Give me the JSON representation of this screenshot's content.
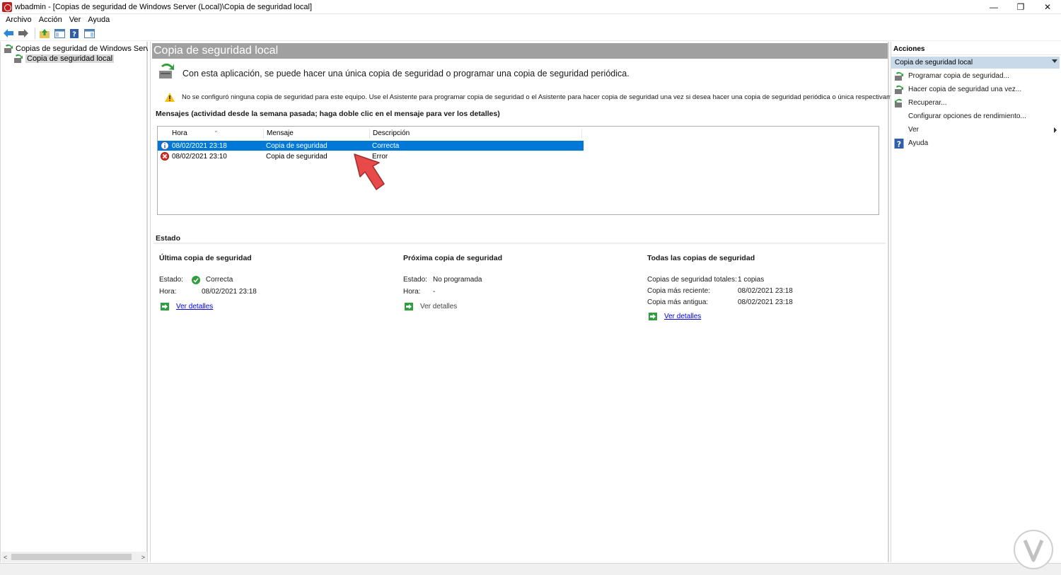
{
  "window": {
    "title": "wbadmin - [Copias de seguridad de Windows Server (Local)\\Copia de seguridad local]",
    "minimize": "—",
    "maximize": "❐",
    "close": "✕"
  },
  "menu": [
    "Archivo",
    "Acción",
    "Ver",
    "Ayuda"
  ],
  "tree": {
    "root": "Copias de seguridad de Windows Server (Local)",
    "child": "Copia de seguridad local"
  },
  "center": {
    "header": "Copia de seguridad local",
    "intro": "Con esta aplicación, se puede hacer una única copia de seguridad o programar una copia de seguridad periódica.",
    "warning": "No se configuró ninguna copia de seguridad para este equipo. Use el Asistente para programar copia de seguridad o el Asistente para hacer copia de seguridad una vez si desea hacer una copia de seguridad periódica o única respectivamente.",
    "messages_heading": "Mensajes (actividad desde la semana pasada; haga doble clic en el mensaje para ver los detalles)",
    "columns": [
      "Hora",
      "Mensaje",
      "Descripción"
    ],
    "rows": [
      {
        "time": "08/02/2021 23:18",
        "message": "Copia de seguridad",
        "description": "Correcta",
        "icon": "info-icon",
        "selected": true
      },
      {
        "time": "08/02/2021 23:10",
        "message": "Copia de seguridad",
        "description": "Error",
        "icon": "error-icon",
        "selected": false
      }
    ],
    "estado_title": "Estado",
    "last": {
      "title": "Última copia de seguridad",
      "estado_label": "Estado:",
      "estado_value": "Correcta",
      "hora_label": "Hora:",
      "hora_value": "08/02/2021 23:18",
      "link": "Ver detalles"
    },
    "next": {
      "title": "Próxima copia de seguridad",
      "estado_label": "Estado:",
      "estado_value": "No programada",
      "hora_label": "Hora:",
      "hora_value": "-",
      "link": "Ver detalles"
    },
    "all": {
      "title": "Todas las copias de seguridad",
      "total_label": "Copias de seguridad totales:",
      "total_value": "1 copias",
      "recent_label": "Copia más reciente:",
      "recent_value": "08/02/2021 23:18",
      "oldest_label": "Copia más antigua:",
      "oldest_value": "08/02/2021 23:18",
      "link": "Ver detalles"
    }
  },
  "actions": {
    "title": "Acciones",
    "section": "Copia de seguridad local",
    "items": [
      "Programar copia de seguridad...",
      "Hacer copia de seguridad una vez...",
      "Recuperar...",
      "Configurar opciones de rendimiento...",
      "Ver",
      "Ayuda"
    ]
  },
  "colors": {
    "selection": "#0078d7",
    "header_bg": "#a0a0a0",
    "link": "#0000ee",
    "pointer": "#e84a4a"
  }
}
